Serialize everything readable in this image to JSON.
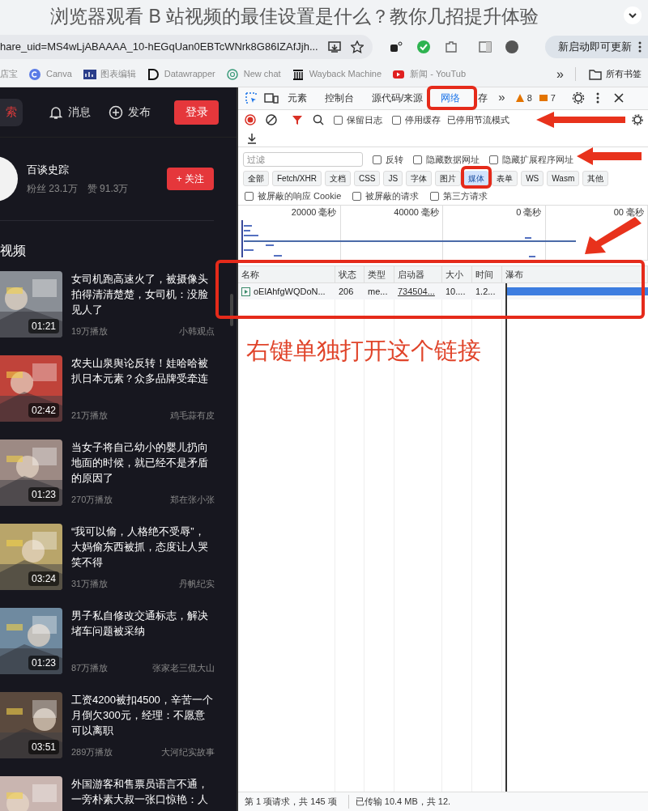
{
  "headline": "浏览器观看 B 站视频的最佳设置是什么？教你几招提升体验",
  "browser": {
    "url": "hare_uid=MS4wLjABAAAA_10-hEGqUan0EBTcWNrk8G86IZAfJjh...",
    "update_label": "新启动即可更新",
    "bookmarks": [
      {
        "label": "店宝",
        "kind": "plain"
      },
      {
        "label": "Canva",
        "kind": "canva"
      },
      {
        "label": "图表编辑",
        "kind": "chart"
      },
      {
        "label": "Datawrapper",
        "kind": "d"
      },
      {
        "label": "New chat",
        "kind": "chat"
      },
      {
        "label": "Wayback Machine",
        "kind": "archive"
      },
      {
        "label": "新闻 - YouTub",
        "kind": "video"
      }
    ],
    "more": "»",
    "all_bookmarks": "所有书签"
  },
  "site": {
    "search_label": "索",
    "messages": "消息",
    "publish": "发布",
    "login": "登录",
    "profile": {
      "name": "百谈史踪",
      "fans_label": "粉丝",
      "fans": "23.1万",
      "likes_label": "赞",
      "likes": "91.3万",
      "follow": "+ 关注"
    },
    "section_title": "视频",
    "videos": [
      {
        "title": "女司机跑高速火了，被摄像头拍得清清楚楚，女司机：没脸见人了",
        "duration": "01:21",
        "plays": "19万播放",
        "author": "小韩观点",
        "color": "#8a8f96"
      },
      {
        "title": "农夫山泉舆论反转！娃哈哈被扒日本元素？众多品牌受牵连",
        "duration": "02:42",
        "plays": "21万播放",
        "author": "鸡毛蒜有皮",
        "color": "#c0433a"
      },
      {
        "title": "当女子将自己幼小的婴儿扔向地面的时候，就已经不是矛盾的原因了",
        "duration": "01:23",
        "plays": "270万播放",
        "author": "郑在张小张",
        "color": "#9d8a84"
      },
      {
        "title": "“我可以偷，人格绝不受辱”，大妈偷东西被抓，态度让人哭笑不得",
        "duration": "03:24",
        "plays": "31万播放",
        "author": "丹帆纪实",
        "color": "#b9a56a"
      },
      {
        "title": "男子私自修改交通标志，解决堵车问题被采纳",
        "duration": "01:23",
        "plays": "87万播放",
        "author": "张家老三侃大山",
        "color": "#6f8aa0"
      },
      {
        "title": "工资4200被扣4500，辛苦一个月倒欠300元，经理：不愿意可以离职",
        "duration": "03:51",
        "plays": "289万播放",
        "author": "大河纪实故事",
        "color": "#5b4a3e"
      },
      {
        "title": "外国游客和售票员语言不通，一旁朴素大叔一张口惊艳：人",
        "color": "#c9b5b0"
      }
    ]
  },
  "devtools": {
    "tabs": [
      {
        "label": "元素",
        "selected": false
      },
      {
        "label": "控制台",
        "selected": false
      },
      {
        "label": "源代码/来源",
        "selected": false
      },
      {
        "label": "网络",
        "selected": true
      },
      {
        "label": "存",
        "selected": false
      }
    ],
    "tab_more": "»",
    "warnings": "8",
    "issues": "7",
    "toolbar_checks": [
      {
        "label": "保留日志",
        "checked": false
      },
      {
        "label": "停用缓存",
        "checked": false
      }
    ],
    "throttle": "已停用节流模式",
    "filter_placeholder": "过滤",
    "filter_checks": [
      {
        "label": "反转",
        "checked": false
      },
      {
        "label": "隐藏数据网址",
        "checked": false
      },
      {
        "label": "隐藏扩展程序网址",
        "checked": false
      }
    ],
    "types": [
      {
        "label": "全部",
        "selected": false
      },
      {
        "label": "Fetch/XHR",
        "selected": false
      },
      {
        "label": "文档",
        "selected": false
      },
      {
        "label": "CSS",
        "selected": false
      },
      {
        "label": "JS",
        "selected": false
      },
      {
        "label": "字体",
        "selected": false
      },
      {
        "label": "图片",
        "selected": false
      },
      {
        "label": "媒体",
        "selected": true
      },
      {
        "label": "表单",
        "selected": false
      },
      {
        "label": "WS",
        "selected": false
      },
      {
        "label": "Wasm",
        "selected": false
      },
      {
        "label": "其他",
        "selected": false
      }
    ],
    "blocked_checks": [
      {
        "label": "被屏蔽的响应 Cookie",
        "checked": false
      },
      {
        "label": "被屏蔽的请求",
        "checked": false
      },
      {
        "label": "第三方请求",
        "checked": false
      }
    ],
    "timeline_ticks": [
      "20000 毫秒",
      "40000 毫秒",
      "0 毫秒",
      "00 毫秒"
    ],
    "columns": [
      "名称",
      "状态",
      "类型",
      "启动器",
      "大小",
      "时间",
      "瀑布"
    ],
    "rows": [
      {
        "name": "oElAhfgWQDoN...",
        "status": "206",
        "type": "me...",
        "initiator": "734504...",
        "size": "10....",
        "time": "1.2..."
      }
    ],
    "status_left": "第 1 项请求，共 145 项",
    "status_right": "已传输 10.4 MB，共 12."
  },
  "annotation": "右键单独打开这个链接"
}
